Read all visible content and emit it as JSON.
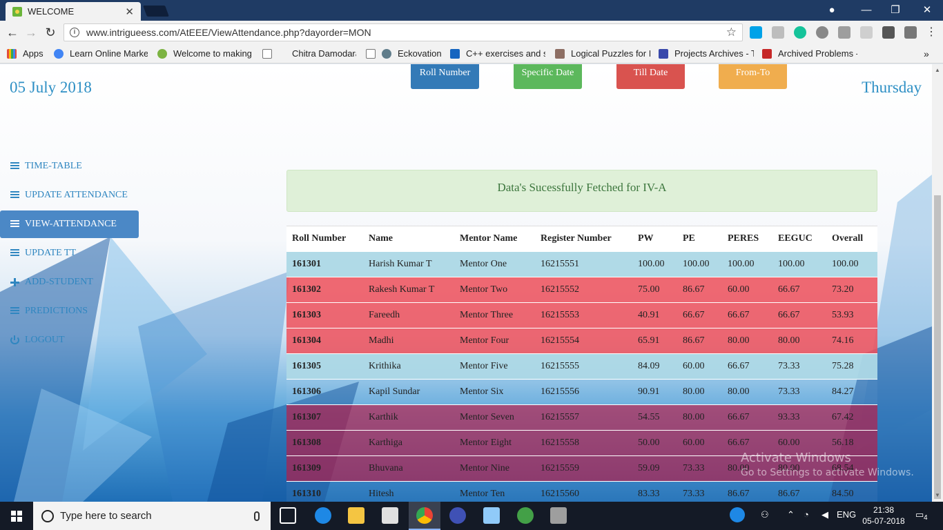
{
  "browser": {
    "tab_title": "WELCOME",
    "url": "www.intrigueess.com/AtEEE/ViewAttendance.php?dayorder=MON",
    "bookmarks": [
      {
        "label": "Apps",
        "color": "#e24c3c"
      },
      {
        "label": "Learn Online Market",
        "color": "#4285f4"
      },
      {
        "label": "Welcome to making",
        "color": "#7cb342"
      },
      {
        "label": "Chitra Damodaran",
        "color": "#9e9e9e"
      },
      {
        "label": "Eckovation",
        "color": "#607d8b"
      },
      {
        "label": "C++ exercises and s",
        "color": "#1565c0"
      },
      {
        "label": "Logical Puzzles for In",
        "color": "#8d6e63"
      },
      {
        "label": "Projects Archives - T",
        "color": "#3949ab"
      },
      {
        "label": "Archived Problems -",
        "color": "#c62828"
      }
    ]
  },
  "header": {
    "date": "05 July 2018",
    "day": "Thursday",
    "buttons": [
      {
        "label": "Roll Number",
        "color": "#337ab7"
      },
      {
        "label": "Specific Date",
        "color": "#5cb85c"
      },
      {
        "label": "Till Date",
        "color": "#d9534f"
      },
      {
        "label": "From-To",
        "color": "#f0ad4e"
      }
    ]
  },
  "sidebar": {
    "items": [
      {
        "label": "TIME-TABLE",
        "icon": "calendar-icon"
      },
      {
        "label": "UPDATE ATTENDANCE",
        "icon": "list-icon"
      },
      {
        "label": "VIEW-ATTENDANCE",
        "icon": "list-icon"
      },
      {
        "label": "UPDATE TT",
        "icon": "list-icon"
      },
      {
        "label": "ADD-STUDENT",
        "icon": "plus-icon"
      },
      {
        "label": "PREDICTIONS",
        "icon": "list-icon"
      },
      {
        "label": "LOGOUT",
        "icon": "power-icon"
      }
    ]
  },
  "alert": {
    "message": "Data's Sucessfully Fetched for IV-A"
  },
  "table": {
    "columns": [
      "Roll Number",
      "Name",
      "Mentor Name",
      "Register Number",
      "PW",
      "PE",
      "PERES",
      "EEGUC",
      "Overall"
    ],
    "rows": [
      {
        "style": "blue",
        "cells": [
          "161301",
          "Harish Kumar T",
          "Mentor One",
          "16215551",
          "100.00",
          "100.00",
          "100.00",
          "100.00",
          "100.00"
        ]
      },
      {
        "style": "red",
        "cells": [
          "161302",
          "Rakesh Kumar T",
          "Mentor Two",
          "16215552",
          "75.00",
          "86.67",
          "60.00",
          "66.67",
          "73.20"
        ]
      },
      {
        "style": "red",
        "cells": [
          "161303",
          "Fareedh",
          "Mentor Three",
          "16215553",
          "40.91",
          "66.67",
          "66.67",
          "66.67",
          "53.93"
        ]
      },
      {
        "style": "red",
        "cells": [
          "161304",
          "Madhi",
          "Mentor Four",
          "16215554",
          "65.91",
          "86.67",
          "80.00",
          "80.00",
          "74.16"
        ]
      },
      {
        "style": "blue",
        "cells": [
          "161305",
          "Krithika",
          "Mentor Five",
          "16215555",
          "84.09",
          "60.00",
          "66.67",
          "73.33",
          "75.28"
        ]
      },
      {
        "style": "clear",
        "cells": [
          "161306",
          "Kapil Sundar",
          "Mentor Six",
          "16215556",
          "90.91",
          "80.00",
          "80.00",
          "73.33",
          "84.27"
        ]
      },
      {
        "style": "dark",
        "cells": [
          "161307",
          "Karthik",
          "Mentor Seven",
          "16215557",
          "54.55",
          "80.00",
          "66.67",
          "93.33",
          "67.42"
        ]
      },
      {
        "style": "dark",
        "cells": [
          "161308",
          "Karthiga",
          "Mentor Eight",
          "16215558",
          "50.00",
          "60.00",
          "66.67",
          "60.00",
          "56.18"
        ]
      },
      {
        "style": "dark",
        "cells": [
          "161309",
          "Bhuvana",
          "Mentor Nine",
          "16215559",
          "59.09",
          "73.33",
          "80.00",
          "80.00",
          "68.54"
        ]
      },
      {
        "style": "clear",
        "cells": [
          "161310",
          "Hitesh",
          "Mentor Ten",
          "16215560",
          "83.33",
          "73.33",
          "86.67",
          "86.67",
          "84.50"
        ]
      }
    ]
  },
  "watermark": {
    "title": "Activate Windows",
    "subtitle": "Go to Settings to activate Windows."
  },
  "taskbar": {
    "search_placeholder": "Type here to search",
    "language": "ENG",
    "time": "21:38",
    "date": "05-07-2018",
    "notification_count": "4"
  }
}
